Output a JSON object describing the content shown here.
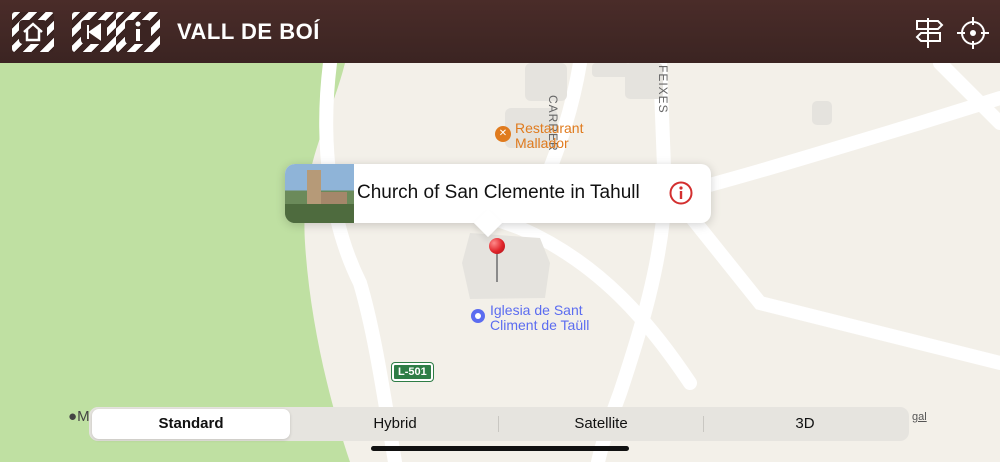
{
  "header": {
    "title": "VALL DE BOÍ",
    "home_icon": "home-icon",
    "back_icon": "back-icon",
    "info_icon": "info-icon",
    "signpost_icon": "signpost-icon",
    "locate_icon": "crosshair-icon"
  },
  "map": {
    "poi_restaurant": "Restaurant\nMallador",
    "poi_church": "Iglesia de Sant\nCliment de Taüll",
    "road_badge": "L-501",
    "street_1": "CARRER",
    "street_2": "FEIXES",
    "legal": "gal",
    "apple_maps_prefix": "M"
  },
  "callout": {
    "title": "Church of San Clemente in Tahull",
    "info_icon": "info-circle-icon"
  },
  "map_types": {
    "options": [
      "Standard",
      "Hybrid",
      "Satellite",
      "3D"
    ],
    "selected": "Standard"
  },
  "colors": {
    "header_bg": "#3b2422",
    "park_green": "#bfe0a2",
    "pin_red": "#e0242a",
    "info_red": "#d32f2f",
    "restaurant_orange": "#e07b1e",
    "church_blue": "#5b6cf0",
    "road_badge_green": "#2e7d46"
  }
}
